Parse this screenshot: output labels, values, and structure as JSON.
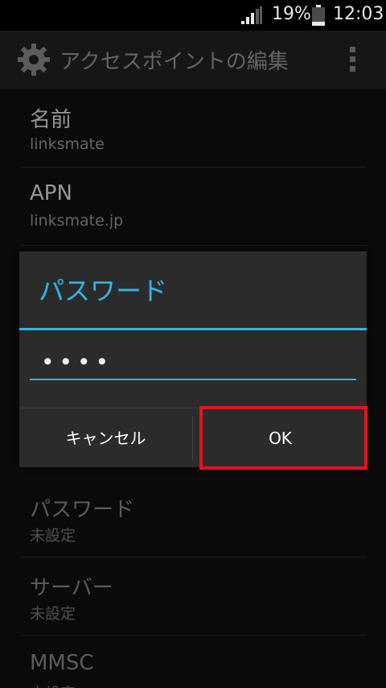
{
  "statusbar": {
    "battery_percent": "19%",
    "time": "12:03",
    "icons": [
      "signal-icon",
      "battery-icon"
    ]
  },
  "actionbar": {
    "title": "アクセスポイントの編集",
    "icon": "gear-icon",
    "overflow_icon": "overflow-menu-icon"
  },
  "settings": [
    {
      "title": "名前",
      "value": "linksmate"
    },
    {
      "title": "APN",
      "value": "linksmate.jp"
    },
    {
      "title": "パスワード",
      "value": "未設定"
    },
    {
      "title": "サーバー",
      "value": "未設定"
    },
    {
      "title": "MMSC",
      "value": "未設定"
    }
  ],
  "dialog": {
    "title": "パスワード",
    "input_value": "••••",
    "cancel_label": "キャンセル",
    "ok_label": "OK"
  },
  "colors": {
    "accent": "#33b5e5",
    "highlight": "#e3141b",
    "background": "#101010",
    "dialog_bg": "#2b2b2b"
  }
}
